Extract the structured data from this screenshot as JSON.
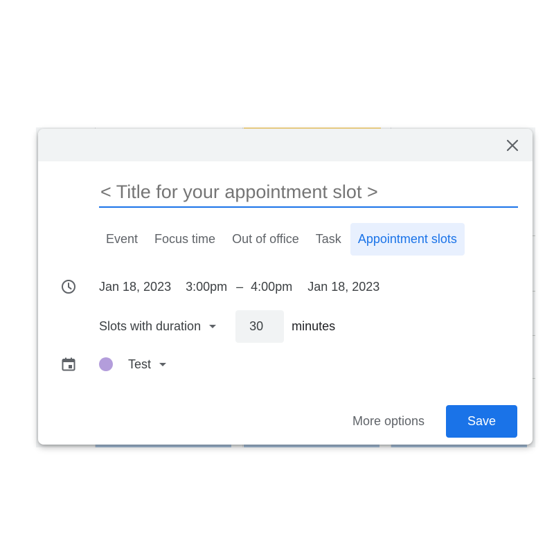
{
  "dialog": {
    "close_icon": "close-icon",
    "title_placeholder": "< Title for your appointment slot >",
    "tabs": [
      {
        "label": "Event",
        "active": false
      },
      {
        "label": "Focus time",
        "active": false
      },
      {
        "label": "Out of office",
        "active": false
      },
      {
        "label": "Task",
        "active": false
      },
      {
        "label": "Appointment slots",
        "active": true
      }
    ],
    "time": {
      "icon": "clock-icon",
      "start_date": "Jan 18, 2023",
      "start_time": "3:00pm",
      "separator": "–",
      "end_time": "4:00pm",
      "end_date": "Jan 18, 2023"
    },
    "slots": {
      "mode_label": "Slots with duration",
      "duration_value": "30",
      "unit": "minutes"
    },
    "calendar": {
      "icon": "calendar-icon",
      "name": "Test",
      "color": "#b39ddb"
    },
    "actions": {
      "more_options": "More options",
      "save": "Save"
    }
  },
  "colors": {
    "accent": "#1a73e8",
    "accent_bg": "#e8f0fe",
    "header_bg": "#f1f3f4"
  }
}
